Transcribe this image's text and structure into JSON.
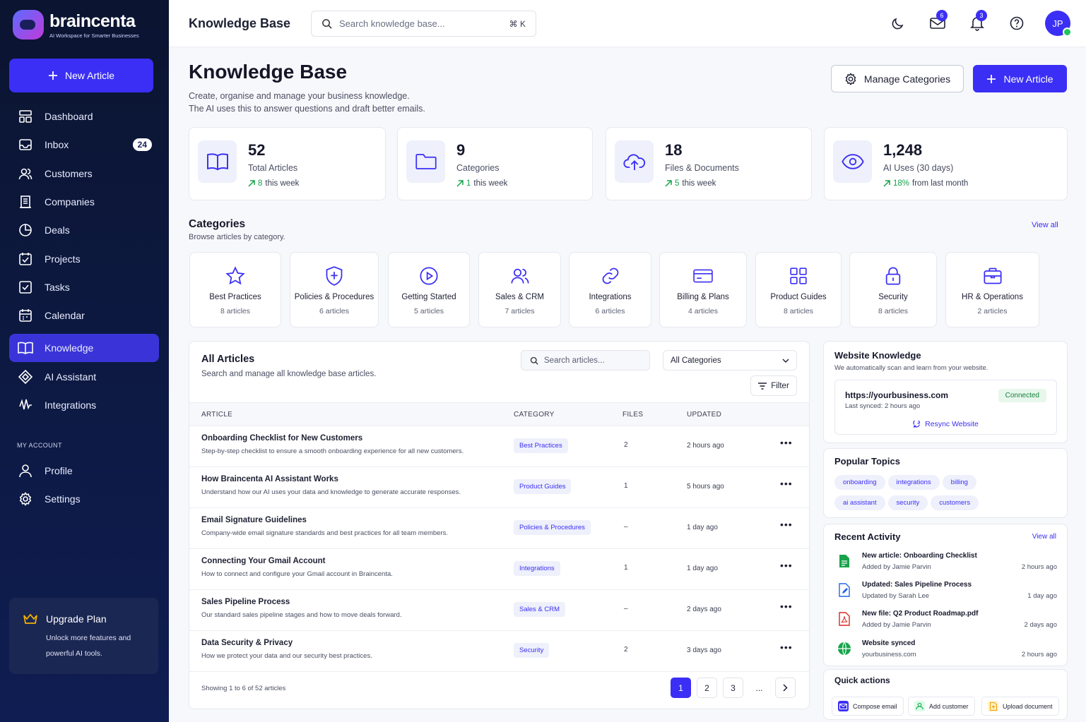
{
  "app": {
    "name": "braincenta",
    "tagline": "AI Workspace for Smarter Businesses"
  },
  "sidebar": {
    "new_article": "New Article",
    "items": [
      {
        "label": "Dashboard",
        "icon": "dashboard-icon"
      },
      {
        "label": "Inbox",
        "icon": "inbox-icon",
        "badge": "24"
      },
      {
        "label": "Customers",
        "icon": "users-icon"
      },
      {
        "label": "Companies",
        "icon": "building-icon"
      },
      {
        "label": "Deals",
        "icon": "deals-icon"
      },
      {
        "label": "Projects",
        "icon": "projects-icon"
      },
      {
        "label": "Tasks",
        "icon": "tasks-icon"
      },
      {
        "label": "Calendar",
        "icon": "calendar-icon"
      },
      {
        "label": "Knowledge",
        "icon": "book-icon",
        "active": true
      },
      {
        "label": "AI Assistant",
        "icon": "ai-icon"
      },
      {
        "label": "Integrations",
        "icon": "integrations-icon"
      }
    ],
    "account_label": "MY ACCOUNT",
    "account_items": [
      {
        "label": "Profile",
        "icon": "user-icon"
      },
      {
        "label": "Settings",
        "icon": "gear-icon"
      }
    ],
    "upgrade": {
      "title": "Upgrade Plan",
      "desc": "Unlock more features and powerful AI tools."
    }
  },
  "topbar": {
    "title": "Knowledge Base",
    "search_placeholder": "Search knowledge base...",
    "shortcut": "⌘ K",
    "mail_count": "6",
    "notif_count": "3",
    "avatar": "JP"
  },
  "page": {
    "title": "Knowledge Base",
    "desc1": "Create, organise and manage your business knowledge.",
    "desc2": "The AI uses this to answer questions and draft better emails.",
    "manage_btn": "Manage Categories",
    "new_btn": "New Article"
  },
  "stats": [
    {
      "num": "52",
      "label": "Total Articles",
      "delta_val": "8",
      "delta_text": "this week",
      "icon": "book-icon"
    },
    {
      "num": "9",
      "label": "Categories",
      "delta_val": "1",
      "delta_text": "this week",
      "icon": "folder-icon"
    },
    {
      "num": "18",
      "label": "Files & Documents",
      "delta_val": "5",
      "delta_text": "this week",
      "icon": "upload-cloud-icon"
    },
    {
      "num": "1,248",
      "label": "AI Uses (30 days)",
      "delta_val": "18%",
      "delta_text": "from last month",
      "icon": "eye-icon"
    }
  ],
  "categories": {
    "title": "Categories",
    "subtitle": "Browse articles by category.",
    "view_all": "View all",
    "items": [
      {
        "name": "Best Practices",
        "count": "8 articles",
        "icon": "star-icon"
      },
      {
        "name": "Policies & Procedures",
        "count": "6 articles",
        "icon": "shield-icon"
      },
      {
        "name": "Getting Started",
        "count": "5 articles",
        "icon": "play-icon"
      },
      {
        "name": "Sales & CRM",
        "count": "7 articles",
        "icon": "users-icon"
      },
      {
        "name": "Integrations",
        "count": "6 articles",
        "icon": "link-icon"
      },
      {
        "name": "Billing & Plans",
        "count": "4 articles",
        "icon": "credit-card-icon"
      },
      {
        "name": "Product Guides",
        "count": "8 articles",
        "icon": "grid-icon"
      },
      {
        "name": "Security",
        "count": "8 articles",
        "icon": "lock-icon"
      },
      {
        "name": "HR & Operations",
        "count": "2 articles",
        "icon": "briefcase-icon"
      }
    ]
  },
  "articles": {
    "title": "All Articles",
    "subtitle": "Search and manage all knowledge base articles.",
    "search_placeholder": "Search articles...",
    "category_select": "All Categories",
    "filter": "Filter",
    "columns": [
      "ARTICLE",
      "CATEGORY",
      "FILES",
      "UPDATED"
    ],
    "rows": [
      {
        "title": "Onboarding Checklist for New Customers",
        "desc": "Step-by-step checklist to ensure a smooth onboarding experience for all new customers.",
        "category": "Best Practices",
        "files": "2",
        "updated": "2 hours ago"
      },
      {
        "title": "How Braincenta AI Assistant Works",
        "desc": "Understand how our AI uses your data and knowledge to generate accurate responses.",
        "category": "Product Guides",
        "files": "1",
        "updated": "5 hours ago"
      },
      {
        "title": "Email Signature Guidelines",
        "desc": "Company-wide email signature standards and best practices for all team members.",
        "category": "Policies & Procedures",
        "files": "–",
        "updated": "1 day ago"
      },
      {
        "title": "Connecting Your Gmail Account",
        "desc": "How to connect and configure your Gmail account in Braincenta.",
        "category": "Integrations",
        "files": "1",
        "updated": "1 day ago"
      },
      {
        "title": "Sales Pipeline Process",
        "desc": "Our standard sales pipeline stages and how to move deals forward.",
        "category": "Sales & CRM",
        "files": "–",
        "updated": "2 days ago"
      },
      {
        "title": "Data Security & Privacy",
        "desc": "How we protect your data and our security best practices.",
        "category": "Security",
        "files": "2",
        "updated": "3 days ago"
      }
    ],
    "showing": "Showing 1 to 6 of 52 articles",
    "pages": [
      "1",
      "2",
      "3",
      "..."
    ]
  },
  "website": {
    "title": "Website Knowledge",
    "subtitle": "We automatically scan and learn from your website.",
    "url": "https://yourbusiness.com",
    "synced": "Last synced: 2 hours ago",
    "status": "Connected",
    "resync": "Resync Website"
  },
  "topics": {
    "title": "Popular Topics",
    "items": [
      "onboarding",
      "integrations",
      "billing",
      "ai assistant",
      "security",
      "customers"
    ]
  },
  "activity": {
    "title": "Recent Activity",
    "view_all": "View all",
    "items": [
      {
        "title": "New article: Onboarding Checklist",
        "sub": "Added by Jamie Parvin",
        "time": "2 hours ago",
        "icon": "doc-green-icon",
        "color": "#16a34a"
      },
      {
        "title": "Updated: Sales Pipeline Process",
        "sub": "Updated by Sarah Lee",
        "time": "1 day ago",
        "icon": "doc-blue-icon",
        "color": "#2563eb"
      },
      {
        "title": "New file: Q2 Product Roadmap.pdf",
        "sub": "Added by Jamie Parvin",
        "time": "2 days ago",
        "icon": "pdf-icon",
        "color": "#dc2626"
      },
      {
        "title": "Website synced",
        "sub": "yourbusiness.com",
        "time": "2 hours ago",
        "icon": "globe-icon",
        "color": "#16a34a"
      }
    ]
  },
  "quick_actions": {
    "title": "Quick actions",
    "items": [
      {
        "label": "Compose email",
        "icon": "mail-icon",
        "color": "#3b2ff5"
      },
      {
        "label": "Add customer",
        "icon": "user-add-icon",
        "color": "#16a34a"
      },
      {
        "label": "Upload document",
        "icon": "upload-doc-icon",
        "color": "#f59e0b"
      }
    ]
  },
  "colors": {
    "accent": "#3b2ff5",
    "sidebar": "#0d1a45",
    "success": "#15a34a"
  }
}
